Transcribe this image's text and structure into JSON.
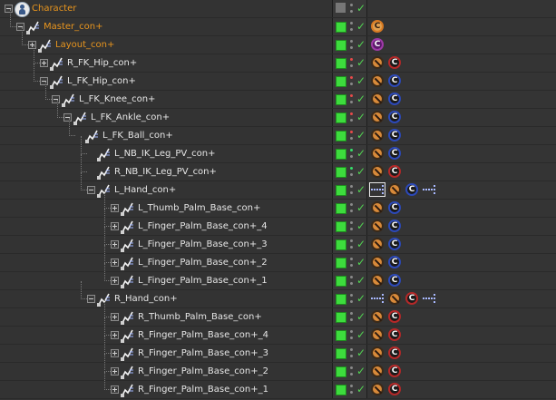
{
  "objects": [
    {
      "label": "Character",
      "depth": 0,
      "color": "orange",
      "icon": "character-icon",
      "expander": "open",
      "layer": false,
      "dots": [
        "gray",
        "gray"
      ],
      "tags": []
    },
    {
      "label": "Master_con+",
      "depth": 1,
      "color": "orange",
      "icon": "spline-icon",
      "expander": "open",
      "layer": true,
      "dots": [
        "gray",
        "gray"
      ],
      "tags": [
        {
          "kind": "c",
          "color": "orange"
        }
      ]
    },
    {
      "label": "Layout_con+",
      "depth": 2,
      "color": "orange",
      "icon": "spline-icon",
      "expander": "closed",
      "layer": true,
      "dots": [
        "gray",
        "gray"
      ],
      "tags": [
        {
          "kind": "c",
          "color": "purple"
        }
      ]
    },
    {
      "label": "R_FK_Hip_con+",
      "depth": 3,
      "color": "white",
      "icon": "spline-icon",
      "expander": "closed",
      "layer": true,
      "dots": [
        "red",
        "gray"
      ],
      "tags": [
        {
          "kind": "protect"
        },
        {
          "kind": "c",
          "color": "red"
        }
      ]
    },
    {
      "label": "L_FK_Hip_con+",
      "depth": 3,
      "color": "white",
      "icon": "spline-icon",
      "expander": "open",
      "layer": true,
      "dots": [
        "red",
        "gray"
      ],
      "tags": [
        {
          "kind": "protect"
        },
        {
          "kind": "c",
          "color": "blue"
        }
      ]
    },
    {
      "label": "L_FK_Knee_con+",
      "depth": 4,
      "color": "white",
      "icon": "spline-icon",
      "expander": "open",
      "layer": true,
      "dots": [
        "red",
        "gray"
      ],
      "tags": [
        {
          "kind": "protect"
        },
        {
          "kind": "c",
          "color": "blue"
        }
      ]
    },
    {
      "label": "L_FK_Ankle_con+",
      "depth": 5,
      "color": "white",
      "icon": "spline-icon",
      "expander": "open",
      "layer": true,
      "dots": [
        "red",
        "gray"
      ],
      "tags": [
        {
          "kind": "protect"
        },
        {
          "kind": "c",
          "color": "blue"
        }
      ]
    },
    {
      "label": "L_FK_Ball_con+",
      "depth": 6,
      "color": "white",
      "icon": "spline-icon",
      "expander": "none",
      "layer": true,
      "dots": [
        "red",
        "gray"
      ],
      "tags": [
        {
          "kind": "protect"
        },
        {
          "kind": "c",
          "color": "blue"
        }
      ]
    },
    {
      "label": "L_NB_IK_Leg_PV_con+",
      "depth": 7,
      "color": "white",
      "icon": "spline-icon",
      "expander": "none",
      "layer": true,
      "dots": [
        "green",
        "gray"
      ],
      "tags": [
        {
          "kind": "protect"
        },
        {
          "kind": "c",
          "color": "blue"
        }
      ]
    },
    {
      "label": "R_NB_IK_Leg_PV_con+",
      "depth": 7,
      "color": "white",
      "icon": "spline-icon",
      "expander": "none",
      "layer": true,
      "dots": [
        "green",
        "gray"
      ],
      "tags": [
        {
          "kind": "protect"
        },
        {
          "kind": "c",
          "color": "red"
        }
      ]
    },
    {
      "label": "L_Hand_con+",
      "depth": 7,
      "color": "white",
      "icon": "spline-icon",
      "expander": "open",
      "layer": true,
      "dots": [
        "gray",
        "gray"
      ],
      "tags": [
        {
          "kind": "ik",
          "selected": true
        },
        {
          "kind": "protect"
        },
        {
          "kind": "c",
          "color": "blue"
        },
        {
          "kind": "ik"
        }
      ]
    },
    {
      "label": "L_Thumb_Palm_Base_con+",
      "depth": 9,
      "color": "white",
      "icon": "spline-icon",
      "expander": "closed",
      "layer": true,
      "dots": [
        "gray",
        "gray"
      ],
      "tags": [
        {
          "kind": "protect"
        },
        {
          "kind": "c",
          "color": "blue"
        }
      ]
    },
    {
      "label": "L_Finger_Palm_Base_con+_4",
      "depth": 9,
      "color": "white",
      "icon": "spline-icon",
      "expander": "closed",
      "layer": true,
      "dots": [
        "gray",
        "gray"
      ],
      "tags": [
        {
          "kind": "protect"
        },
        {
          "kind": "c",
          "color": "blue"
        }
      ]
    },
    {
      "label": "L_Finger_Palm_Base_con+_3",
      "depth": 9,
      "color": "white",
      "icon": "spline-icon",
      "expander": "closed",
      "layer": true,
      "dots": [
        "gray",
        "gray"
      ],
      "tags": [
        {
          "kind": "protect"
        },
        {
          "kind": "c",
          "color": "blue"
        }
      ]
    },
    {
      "label": "L_Finger_Palm_Base_con+_2",
      "depth": 9,
      "color": "white",
      "icon": "spline-icon",
      "expander": "closed",
      "layer": true,
      "dots": [
        "gray",
        "gray"
      ],
      "tags": [
        {
          "kind": "protect"
        },
        {
          "kind": "c",
          "color": "blue"
        }
      ]
    },
    {
      "label": "L_Finger_Palm_Base_con+_1",
      "depth": 9,
      "color": "white",
      "icon": "spline-icon",
      "expander": "closed",
      "layer": true,
      "dots": [
        "gray",
        "gray"
      ],
      "tags": [
        {
          "kind": "protect"
        },
        {
          "kind": "c",
          "color": "blue"
        }
      ]
    },
    {
      "label": "R_Hand_con+",
      "depth": 7,
      "color": "white",
      "icon": "spline-icon",
      "expander": "open",
      "layer": true,
      "dots": [
        "gray",
        "gray"
      ],
      "tags": [
        {
          "kind": "ik"
        },
        {
          "kind": "protect"
        },
        {
          "kind": "c",
          "color": "red"
        },
        {
          "kind": "ik"
        }
      ]
    },
    {
      "label": "R_Thumb_Palm_Base_con+",
      "depth": 9,
      "color": "white",
      "icon": "spline-icon",
      "expander": "closed",
      "layer": true,
      "dots": [
        "gray",
        "gray"
      ],
      "tags": [
        {
          "kind": "protect"
        },
        {
          "kind": "c",
          "color": "red"
        }
      ]
    },
    {
      "label": "R_Finger_Palm_Base_con+_4",
      "depth": 9,
      "color": "white",
      "icon": "spline-icon",
      "expander": "closed",
      "layer": true,
      "dots": [
        "gray",
        "gray"
      ],
      "tags": [
        {
          "kind": "protect"
        },
        {
          "kind": "c",
          "color": "red"
        }
      ]
    },
    {
      "label": "R_Finger_Palm_Base_con+_3",
      "depth": 9,
      "color": "white",
      "icon": "spline-icon",
      "expander": "closed",
      "layer": true,
      "dots": [
        "gray",
        "gray"
      ],
      "tags": [
        {
          "kind": "protect"
        },
        {
          "kind": "c",
          "color": "red"
        }
      ]
    },
    {
      "label": "R_Finger_Palm_Base_con+_2",
      "depth": 9,
      "color": "white",
      "icon": "spline-icon",
      "expander": "closed",
      "layer": true,
      "dots": [
        "gray",
        "gray"
      ],
      "tags": [
        {
          "kind": "protect"
        },
        {
          "kind": "c",
          "color": "red"
        }
      ]
    },
    {
      "label": "R_Finger_Palm_Base_con+_1",
      "depth": 9,
      "color": "white",
      "icon": "spline-icon",
      "expander": "closed",
      "layer": true,
      "dots": [
        "gray",
        "gray"
      ],
      "tags": [
        {
          "kind": "protect"
        },
        {
          "kind": "c",
          "color": "red"
        }
      ]
    }
  ],
  "tag_letter": "C",
  "colors": {
    "orange_label": "#e8951e",
    "white_label": "#e6e6e6",
    "layer_green": "#3ddc3d",
    "tag_red": "#b52828",
    "tag_blue": "#2c49b8"
  }
}
